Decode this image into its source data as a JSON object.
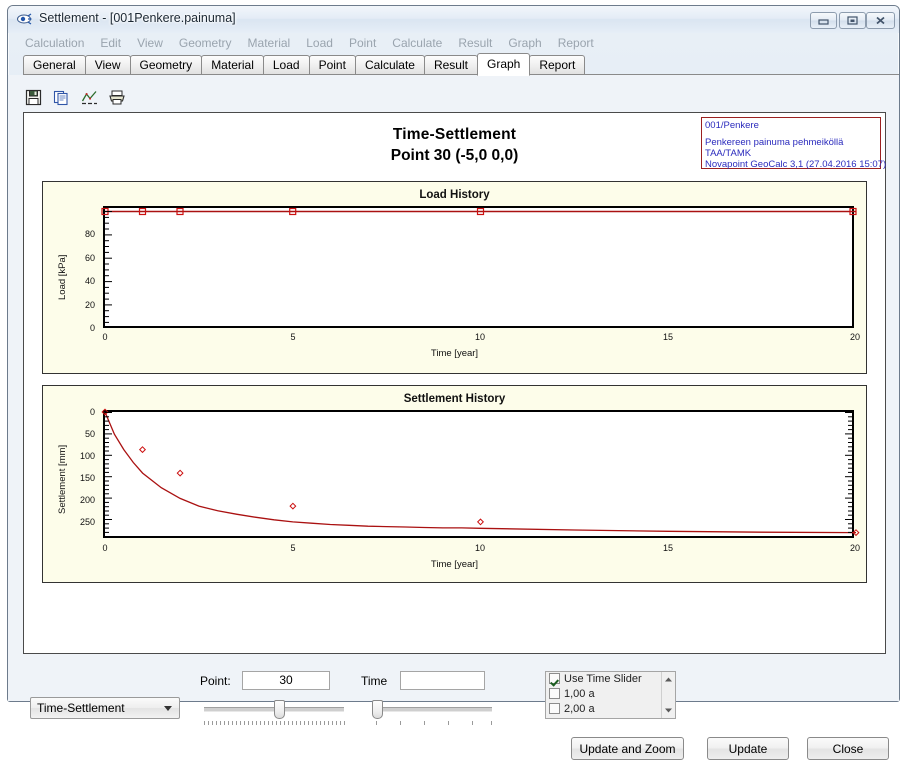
{
  "window": {
    "title": "Settlement - [001Penkere.painuma]",
    "icon": "app-icon",
    "minimize_label": "Minimize",
    "maximize_label": "Maximize",
    "close_label": "Close"
  },
  "menubar": {
    "items": [
      {
        "label": "Calculation"
      },
      {
        "label": "Edit"
      },
      {
        "label": "View"
      },
      {
        "label": "Geometry"
      },
      {
        "label": "Material"
      },
      {
        "label": "Load"
      },
      {
        "label": "Point"
      },
      {
        "label": "Calculate"
      },
      {
        "label": "Result"
      },
      {
        "label": "Graph"
      },
      {
        "label": "Report"
      }
    ]
  },
  "tabs": {
    "active": "Graph",
    "items": [
      {
        "label": "General"
      },
      {
        "label": "View"
      },
      {
        "label": "Geometry"
      },
      {
        "label": "Material"
      },
      {
        "label": "Load"
      },
      {
        "label": "Point"
      },
      {
        "label": "Calculate"
      },
      {
        "label": "Result"
      },
      {
        "label": "Graph"
      },
      {
        "label": "Report"
      }
    ]
  },
  "toolbar": {
    "buttons": [
      {
        "name": "save-icon",
        "title": "Save"
      },
      {
        "name": "copy-icon",
        "title": "Copy"
      },
      {
        "name": "graph-icon",
        "title": "Graph"
      },
      {
        "name": "print-icon",
        "title": "Print"
      }
    ]
  },
  "graph_page": {
    "title": "Time-Settlement",
    "subtitle": "Point 30 (-5,0 0,0)",
    "infobox": {
      "line1": "001/Penkere",
      "line2": "Penkereen painuma pehmeiköllä",
      "line3": "TAA/TAMK",
      "line4": "Novapoint GeoCalc 3,1 (27.04.2016 15:07)",
      "border_color": "#9b2020",
      "text_color": "#2b2bbd"
    }
  },
  "controls": {
    "graph_type_label": "Time-Settlement",
    "point_label": "Point:",
    "point_value": "30",
    "time_label": "Time",
    "time_value": "",
    "time_slider_list": [
      {
        "label": "Use Time Slider",
        "checked": true
      },
      {
        "label": "1,00 a",
        "checked": false
      },
      {
        "label": "2,00 a",
        "checked": false
      }
    ],
    "buttons": {
      "update_and_zoom": "Update and Zoom",
      "update": "Update",
      "close": "Close"
    }
  },
  "chart_data": [
    {
      "type": "line",
      "title": "Load History",
      "xlabel": "Time [year]",
      "ylabel": "Load [kPa]",
      "xlim": [
        0,
        20
      ],
      "ylim": [
        0,
        100
      ],
      "xticks": [
        0,
        5,
        10,
        15,
        20
      ],
      "yticks": [
        0,
        20,
        40,
        60,
        80
      ],
      "grid": false,
      "legend": "none",
      "series": [
        {
          "name": "Load",
          "color": "#aa1111",
          "marker": "square",
          "marker_x": [
            0,
            1,
            2,
            5,
            10,
            20
          ],
          "x": [
            0,
            1,
            2,
            5,
            10,
            15,
            20
          ],
          "values": [
            97,
            97,
            97,
            97,
            97,
            97,
            97
          ]
        }
      ]
    },
    {
      "type": "line",
      "title": "Settlement History",
      "xlabel": "Time [year]",
      "ylabel": "Settlement [mm]",
      "xlim": [
        0,
        20
      ],
      "ylim": [
        290,
        0
      ],
      "y_inverted": true,
      "xticks": [
        0,
        5,
        10,
        15,
        20
      ],
      "yticks": [
        0,
        50,
        100,
        150,
        200,
        250
      ],
      "grid": false,
      "legend": "none",
      "series": [
        {
          "name": "Settlement",
          "color": "#aa1111",
          "marker": "diamond",
          "marker_x": [
            0,
            1,
            2,
            5,
            10,
            20
          ],
          "x": [
            0,
            0.5,
            1,
            1.5,
            2,
            3,
            4,
            5,
            6,
            7,
            8,
            9,
            10,
            11,
            12,
            13,
            14,
            15,
            16,
            17,
            18,
            19,
            20
          ],
          "values": [
            0,
            52,
            88,
            118,
            143,
            177,
            202,
            220,
            231,
            239,
            246,
            252,
            257,
            260,
            263,
            265,
            267,
            268,
            269,
            270,
            271,
            271,
            272
          ]
        }
      ]
    }
  ]
}
